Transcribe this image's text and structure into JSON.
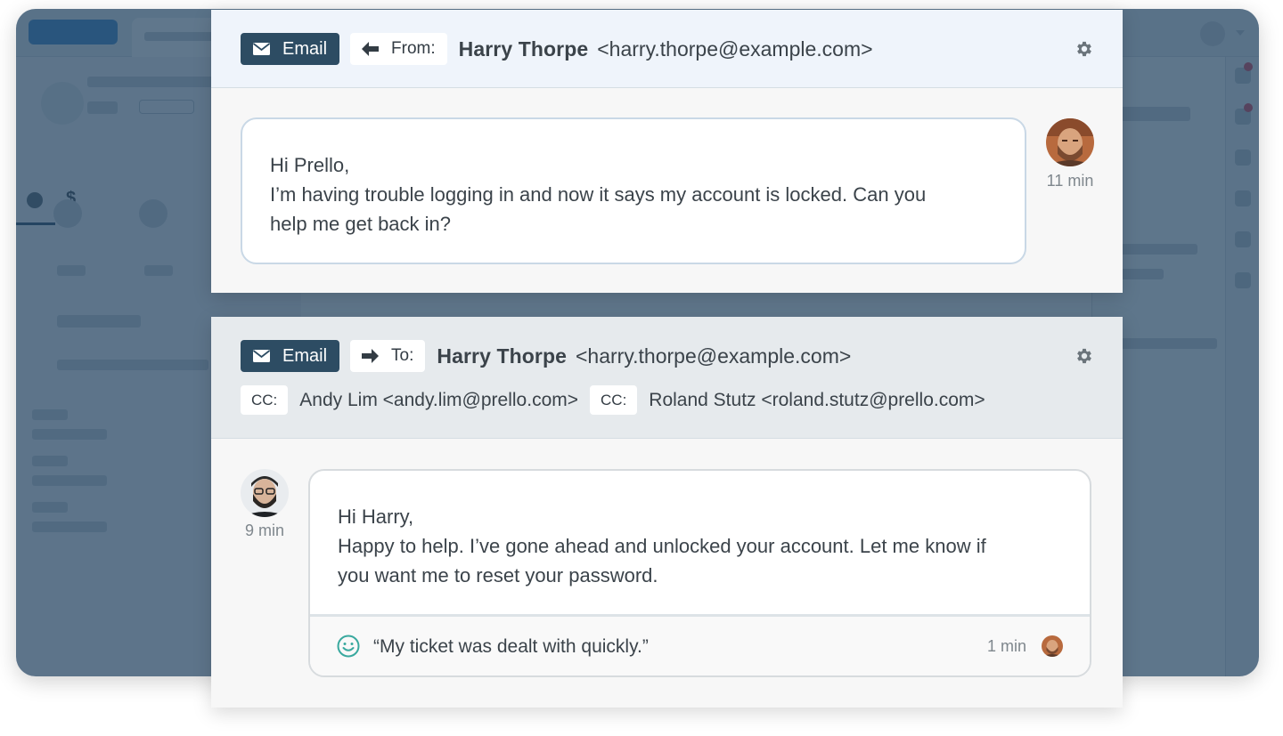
{
  "inbound": {
    "channel_label": "Email",
    "direction_label": "From:",
    "contact_name": "Harry Thorpe",
    "contact_address": "<harry.thorpe@example.com>",
    "message_lines": [
      "Hi Prello,",
      "I’m having trouble logging in and now it says my account is locked.  Can you",
      "help me get back in?"
    ],
    "time": "11 min"
  },
  "outbound": {
    "channel_label": "Email",
    "direction_label": "To:",
    "contact_name": "Harry Thorpe",
    "contact_address": "<harry.thorpe@example.com>",
    "cc": [
      {
        "label": "CC:",
        "value": "Andy Lim <andy.lim@prello.com>"
      },
      {
        "label": "CC:",
        "value": "Roland Stutz <roland.stutz@prello.com>"
      }
    ],
    "message_lines": [
      "Hi Harry,",
      "Happy to help. I’ve gone ahead and unlocked your account. Let me know if",
      "you want me to reset your password."
    ],
    "time": "9 min",
    "rating": {
      "icon": "smile-icon",
      "text": "“My ticket was dealt with quickly.”",
      "time": "1 min"
    }
  },
  "colors": {
    "badge_dark": "#2d4c63",
    "overlay": "#224260",
    "smile": "#3aa99f"
  }
}
